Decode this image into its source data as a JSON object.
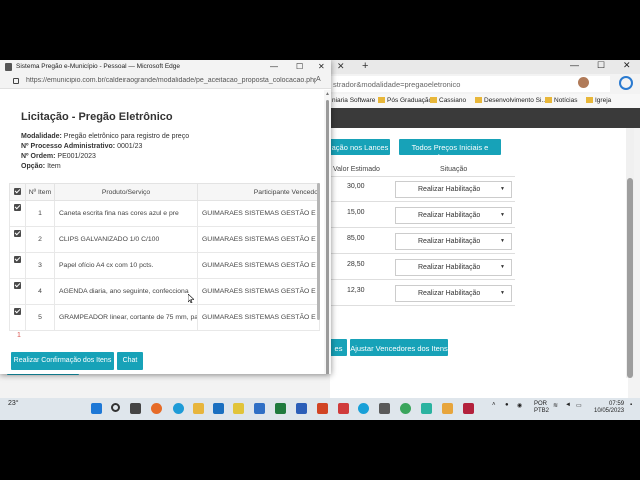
{
  "background_browser": {
    "address_fragment": "strador&modalidade=pregaoeletronico",
    "favorites": [
      "niaria Software",
      "Pós Graduação",
      "Cassiano",
      "Desenvolvimento Si...",
      "Notícias",
      "Igreja"
    ],
    "buttons": {
      "lances": "ação nos Lances",
      "precos": "Todos Preços Iniciais e Lances",
      "left_fragment": "es",
      "ajustar": "Ajustar Vencedores dos Itens"
    },
    "columns": {
      "valor": "Valor Estimado",
      "situacao": "Situação"
    },
    "rows": [
      {
        "valor": "30,00",
        "situacao": "Realizar Habilitação"
      },
      {
        "valor": "15,00",
        "situacao": "Realizar Habilitação"
      },
      {
        "valor": "85,00",
        "situacao": "Realizar Habilitação"
      },
      {
        "valor": "28,50",
        "situacao": "Realizar Habilitação"
      },
      {
        "valor": "12,30",
        "situacao": "Realizar Habilitação"
      }
    ]
  },
  "popup": {
    "window_title": "Sistema Pregão e-Município - Pessoal — Microsoft Edge",
    "url": "https://emunicipio.com.br/caldeiraogrande/modalidade/pe_aceitacao_proposta_colocacao.php?l...",
    "page_title": "Licitação - Pregão Eletrônico",
    "info": [
      {
        "label": "Modalidade:",
        "value": "Pregão eletrônico para registro de preço"
      },
      {
        "label": "Nº Processo Administrativo:",
        "value": "0001/23"
      },
      {
        "label": "Nº Ordem:",
        "value": "PE001/2023"
      },
      {
        "label": "Opção:",
        "value": "Item"
      }
    ],
    "table": {
      "headers": {
        "n_item": "Nº Item",
        "produto": "Produto/Serviço",
        "participante": "Participante Vencedo"
      },
      "rows": [
        {
          "n": "1",
          "produto": "Caneta escrita fina nas cores azul e pre",
          "participante": "GUIMARAES SISTEMAS GESTÃO E TI"
        },
        {
          "n": "2",
          "produto": "CLIPS GALVANIZADO 1/0 C/100",
          "participante": "GUIMARAES SISTEMAS GESTÃO E TI"
        },
        {
          "n": "3",
          "produto": "Papel ofício A4 cx com 10 pcts.",
          "participante": "GUIMARAES SISTEMAS GESTÃO E TI"
        },
        {
          "n": "4",
          "produto": "AGENDA diaria, ano seguinte, confecciona",
          "participante": "GUIMARAES SISTEMAS GESTÃO E TI"
        },
        {
          "n": "5",
          "produto": "GRAMPEADOR linear, cortante de 75 mm, pa",
          "participante": "GUIMARAES SISTEMAS GESTÃO E TI"
        }
      ]
    },
    "pagination": "1",
    "buttons": {
      "confirm": "Realizar Confirmação dos Itens",
      "chat": "Chat"
    }
  },
  "taskbar": {
    "weather": "23°",
    "lang": "POR",
    "layout": "PTB2",
    "time": "07:59",
    "date": "10/05/2023"
  },
  "colors": {
    "accent": "#17a2b8",
    "link": "#2a7ab8",
    "pagination": "#d9534f"
  }
}
